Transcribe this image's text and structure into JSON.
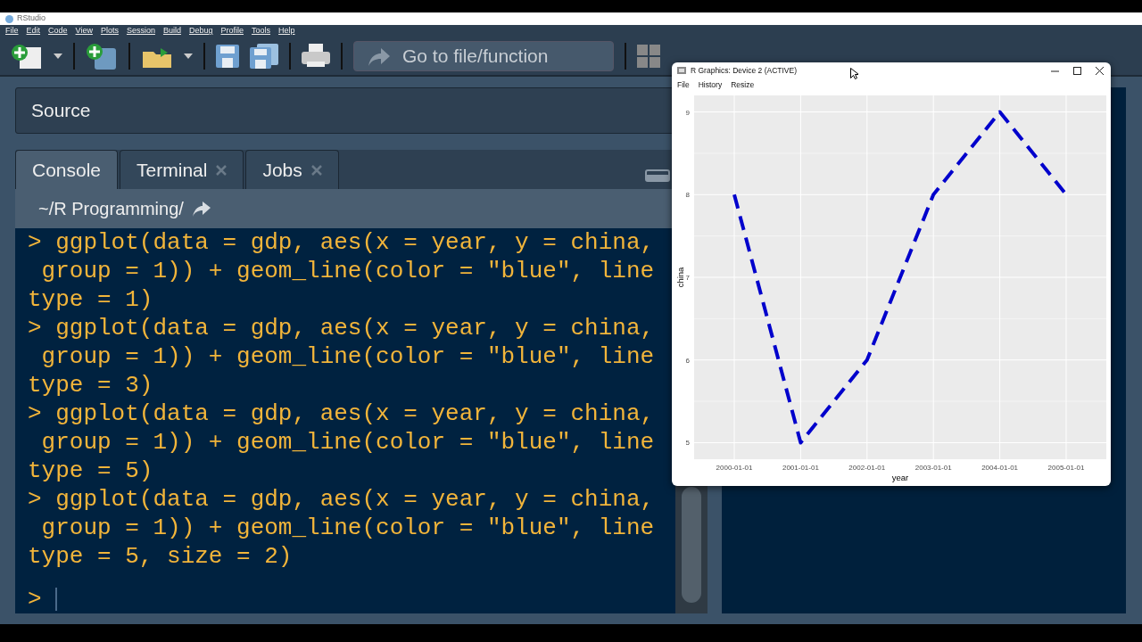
{
  "app": {
    "title": "RStudio"
  },
  "menu": [
    {
      "label": "File"
    },
    {
      "label": "Edit"
    },
    {
      "label": "Code"
    },
    {
      "label": "View"
    },
    {
      "label": "Plots"
    },
    {
      "label": "Session"
    },
    {
      "label": "Build"
    },
    {
      "label": "Debug"
    },
    {
      "label": "Profile"
    },
    {
      "label": "Tools"
    },
    {
      "label": "Help"
    }
  ],
  "toolbar": {
    "goto_placeholder": "Go to file/function"
  },
  "source_pane": {
    "title": "Source"
  },
  "console_pane": {
    "tabs": [
      {
        "label": "Console",
        "selected": true,
        "closable": false
      },
      {
        "label": "Terminal",
        "selected": false,
        "closable": true
      },
      {
        "label": "Jobs",
        "selected": false,
        "closable": true
      }
    ],
    "path": "~/R Programming/",
    "lines": [
      "> ggplot(data = gdp, aes(x = year, y = china,",
      " group = 1)) + geom_line(color = \"blue\", line",
      "type = 1)",
      "> ggplot(data = gdp, aes(x = year, y = china,",
      " group = 1)) + geom_line(color = \"blue\", line",
      "type = 3)",
      "> ggplot(data = gdp, aes(x = year, y = china,",
      " group = 1)) + geom_line(color = \"blue\", line",
      "type = 5)",
      "> ggplot(data = gdp, aes(x = year, y = china,",
      " group = 1)) + geom_line(color = \"blue\", line",
      "type = 5, size = 2)"
    ],
    "prompt": ">"
  },
  "graphics_window": {
    "title": "R Graphics: Device 2 (ACTIVE)",
    "menu": [
      "File",
      "History",
      "Resize"
    ],
    "chart_data": {
      "type": "line",
      "xlabel": "year",
      "ylabel": "china",
      "categories": [
        "2000-01-01",
        "2001-01-01",
        "2002-01-01",
        "2003-01-01",
        "2004-01-01",
        "2005-01-01"
      ],
      "series": [
        {
          "color": "#0000cc",
          "line_style": "dashed",
          "values": [
            8,
            5,
            6,
            8,
            9,
            8
          ]
        }
      ],
      "grid": true,
      "ylim": [
        4.8,
        9.2
      ],
      "yticks": [
        5,
        6,
        7,
        8,
        9
      ]
    }
  }
}
